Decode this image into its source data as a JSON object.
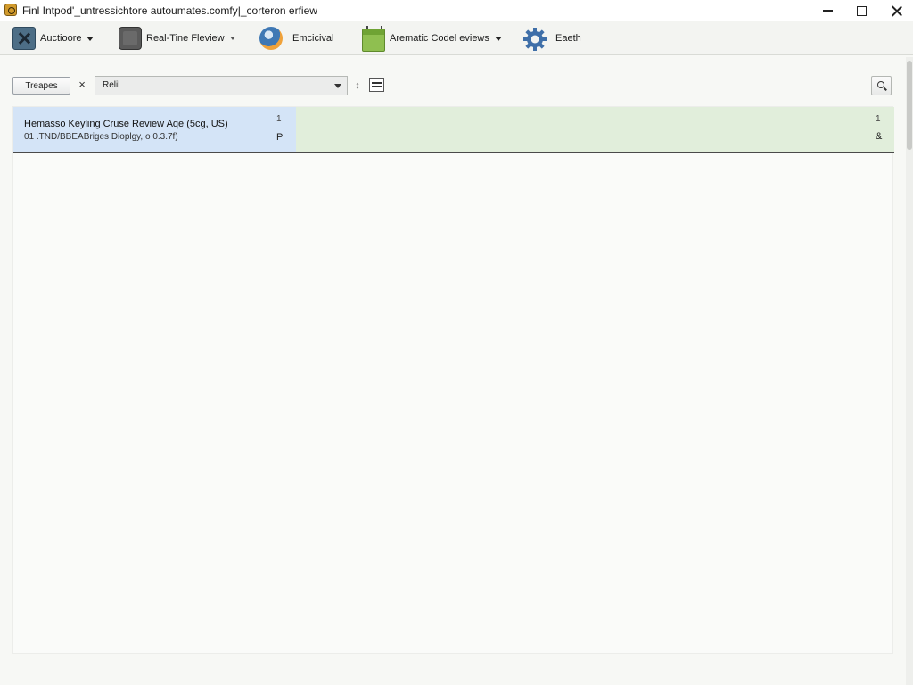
{
  "window": {
    "title": "Finl Intpod'_untressichtore autoumates.comfy|_corteron erfiew"
  },
  "ribbon": {
    "items": [
      {
        "label": "Auctioore",
        "icon": "archive-icon",
        "has_dropdown": true
      },
      {
        "label": "Real-Tine Fleview",
        "icon": "preview-icon",
        "has_dropdown": true
      },
      {
        "label": "Emcicival",
        "icon": "globe-icon",
        "has_dropdown": false
      },
      {
        "label": "Arematic Codel eviews",
        "icon": "calendar-icon",
        "has_dropdown": true
      },
      {
        "label": "Eaeth",
        "icon": "gear-icon",
        "has_dropdown": false
      }
    ]
  },
  "filter": {
    "button_label": "Treapes",
    "clear_glyph": "×",
    "selected_value": "Relil",
    "sort_glyph": "↕"
  },
  "results": {
    "rows": [
      {
        "title": "Hemasso Keyling Cruse Review Aqe (5cg, US)",
        "subtitle": "01 .TND/BBEABriges Dioplgy, o 0.3.7f)",
        "col_a_top": "1",
        "col_a_bottom": "P",
        "col_b_top": "1",
        "col_b_bottom": "&"
      }
    ]
  },
  "colors": {
    "row_left_bg": "#d4e4f7",
    "row_right_bg": "#e1eedb",
    "window_bg": "#f7f8f5"
  }
}
